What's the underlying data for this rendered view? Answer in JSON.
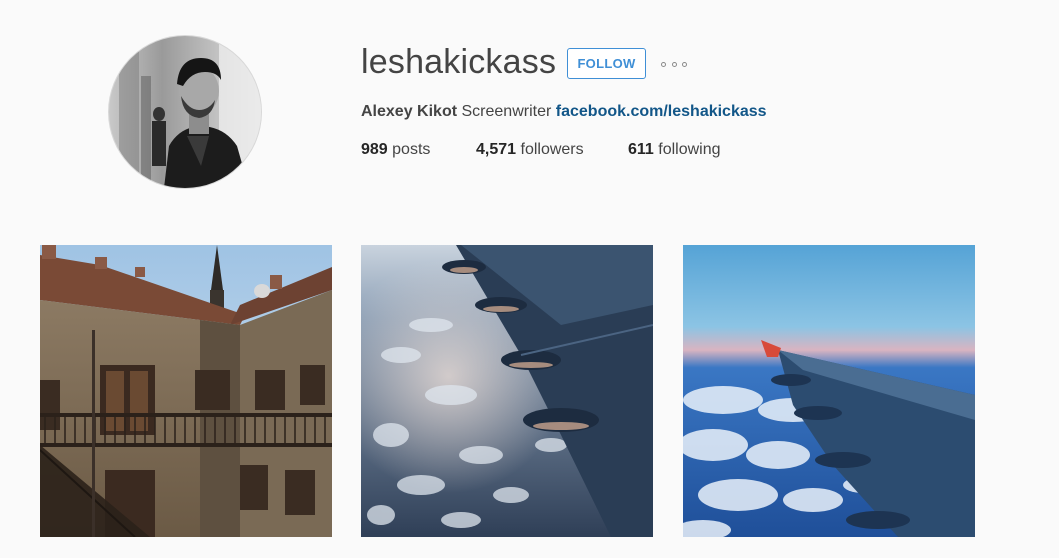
{
  "profile": {
    "username": "leshakickass",
    "follow_label": "FOLLOW",
    "more_icon": "more-options-icon",
    "full_name": "Alexey Kikot",
    "bio": "Screenwriter",
    "link": "facebook.com/leshakickass",
    "avatar_icon": "profile-photo"
  },
  "stats": {
    "posts_count": "989",
    "posts_label": "posts",
    "followers_count": "4,571",
    "followers_label": "followers",
    "following_count": "611",
    "following_label": "following"
  },
  "posts": [
    {
      "subject": "courtyard-building-photo"
    },
    {
      "subject": "airplane-wing-over-ice-photo"
    },
    {
      "subject": "airplane-wing-over-clouds-photo"
    }
  ],
  "colors": {
    "follow_blue": "#3f8fd6",
    "link_blue": "#125688",
    "background": "#fafafa"
  }
}
